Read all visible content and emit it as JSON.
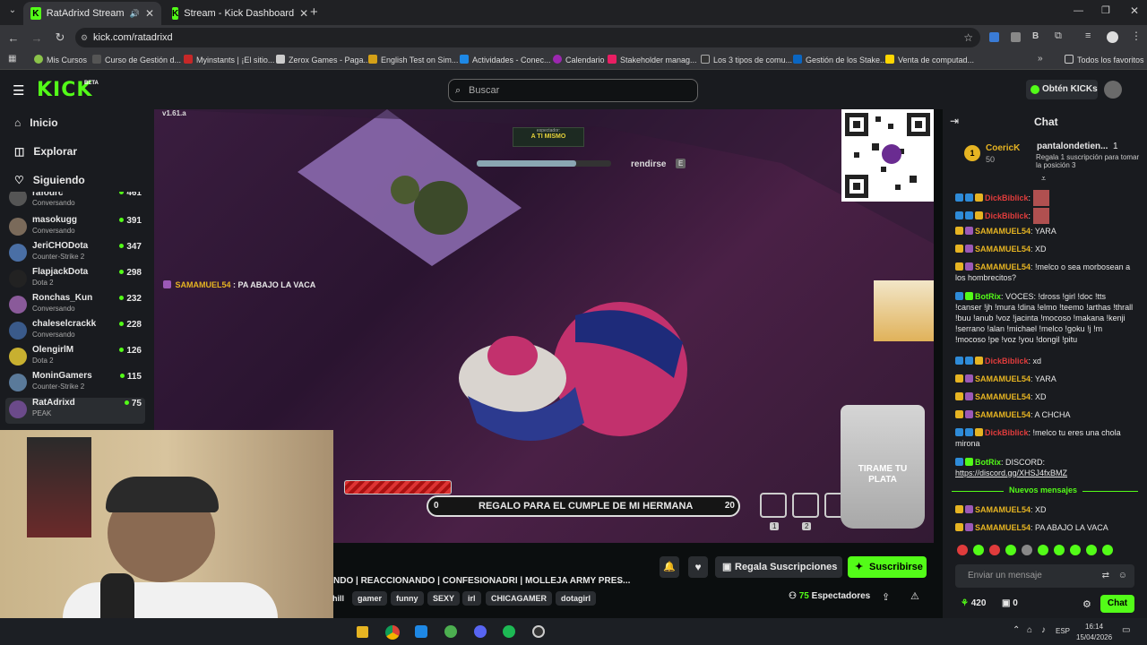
{
  "tabs": [
    {
      "title": "RatAdrixd Stream - Watch l",
      "active": true
    },
    {
      "title": "Stream - Kick Dashboard",
      "active": false
    }
  ],
  "url": "kick.com/ratadrixd",
  "bookmarks": [
    "Mis Cursos",
    "Curso de Gestión d...",
    "Myinstants | ¡El sitio...",
    "Zerox Games - Paga...",
    "English Test on Sim...",
    "Actividades - Conec...",
    "Calendario",
    "Stakeholder manag...",
    "Los 3 tipos de comu...",
    "Gestión de los Stake...",
    "Venta de computad...",
    "Todos los favoritos"
  ],
  "header": {
    "logo": "KICK",
    "beta": "BETA",
    "search_placeholder": "Buscar",
    "kicks_button": "Obtén KICKs"
  },
  "nav": {
    "home": "Inicio",
    "explore": "Explorar",
    "following": "Siguiendo"
  },
  "channels": [
    {
      "name": "rafourc",
      "status": "Conversando",
      "viewers": "461"
    },
    {
      "name": "masokugg",
      "status": "Conversando",
      "viewers": "391"
    },
    {
      "name": "JeriCHODota",
      "status": "Counter-Strike 2",
      "viewers": "347"
    },
    {
      "name": "FlapjackDota",
      "status": "Dota 2",
      "viewers": "298"
    },
    {
      "name": "Ronchas_Kun",
      "status": "Conversando",
      "viewers": "232"
    },
    {
      "name": "chaleselcrackk",
      "status": "Conversando",
      "viewers": "228"
    },
    {
      "name": "OlengirlM",
      "status": "Dota 2",
      "viewers": "126"
    },
    {
      "name": "MoninGamers",
      "status": "Counter-Strike 2",
      "viewers": "115"
    },
    {
      "name": "RatAdrixd",
      "status": "PEAK",
      "viewers": "75"
    }
  ],
  "overlay": {
    "version": "v1.61.a",
    "spectator_label": "espectador:",
    "spectator_value": "A TI MISMO",
    "give_up": "rendirse",
    "give_up_key": "E",
    "overlay_chat_user": "SAMAMUEL54",
    "overlay_chat_text": "PA ABAJO LA VACA",
    "goal_label": "REGALO PARA EL CUMPLE DE MI HERMANA",
    "goal_current": "0",
    "goal_target": "20",
    "tip_jar": "TIRAME TU PLATA",
    "slot1": "1",
    "slot2": "2"
  },
  "stream": {
    "title": "NDO | REACCIONANDO | CONFESIONADRI | MOLLEJA ARMY PRES...",
    "tags": [
      "hill",
      "gamer",
      "funny",
      "SEXY",
      "irl",
      "CHICAGAMER",
      "dotagirl"
    ],
    "gift_subs": "Regala Suscripciones",
    "subscribe": "Suscribirse",
    "viewers": "75",
    "viewers_label": "Espectadores"
  },
  "chat": {
    "title": "Chat",
    "top_gifter_name": "CoericK",
    "top_gifter_count": "50",
    "pinned_user": "pantalondetien...",
    "pinned_count": "1",
    "pinned_text": "Regala 1 suscripción para tomar la posición 3",
    "messages": [
      {
        "user": "DickBiblick",
        "text": "",
        "color": "red"
      },
      {
        "user": "DickBiblick",
        "text": "",
        "color": "red"
      },
      {
        "user": "SAMAMUEL54",
        "text": "YARA",
        "color": "gold"
      },
      {
        "user": "SAMAMUEL54",
        "text": "XD",
        "color": "gold"
      },
      {
        "user": "SAMAMUEL54",
        "text": "!melco o sea morbosean a los hombrecitos?",
        "color": "gold"
      },
      {
        "user": "BotRix",
        "text": "VOCES: !dross !girl !doc !tts !canser !jh !mura !dina !elmo !teemo !arthas !thrall !buu !anub !voz !jacinta !mocoso !makana !kenji !serrano !alan !michael !melco !goku !j !m !mocoso !pe !voz !you !dongil !pitu",
        "color": "green"
      },
      {
        "user": "DickBiblick",
        "text": "xd",
        "color": "red"
      },
      {
        "user": "SAMAMUEL54",
        "text": "YARA",
        "color": "gold"
      },
      {
        "user": "SAMAMUEL54",
        "text": "XD",
        "color": "gold"
      },
      {
        "user": "SAMAMUEL54",
        "text": "A CHCHA",
        "color": "gold"
      },
      {
        "user": "DickBiblick",
        "text": "!melco tu eres una chola mirona",
        "color": "red"
      },
      {
        "user": "BotRix",
        "text": "DISCORD:",
        "color": "green"
      },
      {
        "user": "",
        "text": "https://discord.gg/XHSJ4fxBMZ",
        "color": "link"
      }
    ],
    "new_messages": "Nuevos mensajes",
    "after": [
      {
        "user": "SAMAMUEL54",
        "text": "XD"
      },
      {
        "user": "SAMAMUEL54",
        "text": "PA ABAJO LA VACA"
      }
    ],
    "input_placeholder": "Enviar un mensaje",
    "kicks_count": "420",
    "gift_count": "0",
    "send_button": "Chat"
  },
  "taskbar": {
    "lang": "ESP",
    "time": "16:14",
    "date": "15/04/2026"
  },
  "colors": {
    "brand": "#53fc18",
    "background": "#0b0e0f",
    "panel": "#191b1f"
  }
}
